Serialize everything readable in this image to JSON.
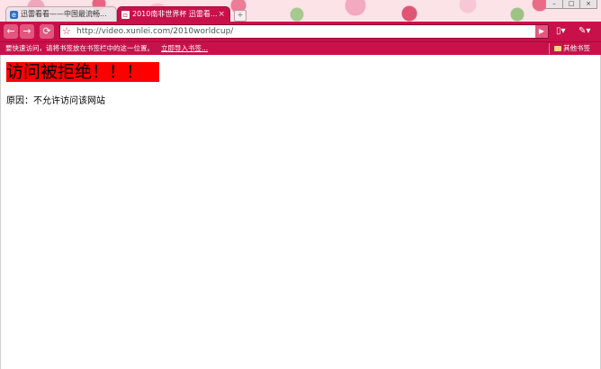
{
  "tabs": [
    {
      "label": "迅雷看看——中国最流畅...",
      "active": false
    },
    {
      "label": "2010南非世界杯 迅雷看...",
      "active": true
    }
  ],
  "toolbar": {
    "back_icon": "back-arrow-icon",
    "forward_icon": "forward-arrow-icon",
    "reload_icon": "reload-icon",
    "star_icon": "star-icon",
    "page_menu_icon": "page-icon",
    "tools_menu_icon": "wrench-icon"
  },
  "address_bar": {
    "url": "http://video.xunlei.com/2010worldcup/"
  },
  "bookmarks_bar": {
    "prompt": "要快速访问，请将书签放在书签栏中的这一位置。",
    "import_link": "立即导入书签...",
    "other_bookmarks": "其他书签"
  },
  "page": {
    "heading": "访问被拒绝！！！",
    "reason": "原因：不允许访问该网站"
  },
  "colors": {
    "theme_accent": "#c8114a",
    "heading_background": "#ff0000"
  }
}
